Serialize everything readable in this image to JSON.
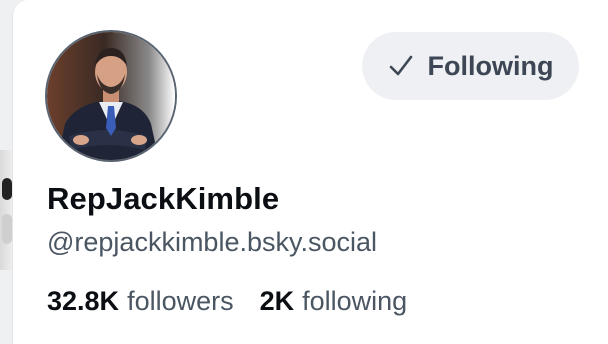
{
  "profile": {
    "display_name": "RepJackKimble",
    "handle": "@repjackkimble.bsky.social",
    "avatar_alt": "avatar"
  },
  "follow_button": {
    "label": "Following",
    "icon": "check-icon"
  },
  "stats": {
    "followers_count": "32.8K",
    "followers_label": "followers",
    "following_count": "2K",
    "following_label": "following"
  },
  "colors": {
    "name_text": "#0b0f14",
    "secondary_text": "#4b5663",
    "button_bg": "#eef0f3",
    "button_text": "#3d4654"
  }
}
